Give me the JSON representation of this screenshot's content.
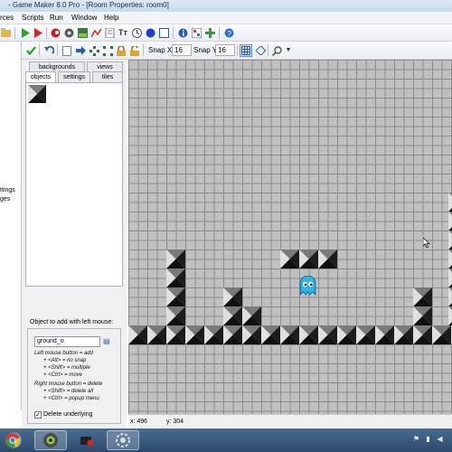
{
  "window": {
    "title": "- Game Maker 8.0 Pro - [Room Properties: room0]"
  },
  "menubar": {
    "items": [
      {
        "label": "rces"
      },
      {
        "label": "Scripts"
      },
      {
        "label": "Run"
      },
      {
        "label": "Window"
      },
      {
        "label": "Help"
      }
    ]
  },
  "room_toolbar": {
    "snap_x_label": "Snap X:",
    "snap_x_value": "16",
    "snap_y_label": "Snap Y:",
    "snap_y_value": "16"
  },
  "left_strip": {
    "fragments": [
      "ttings",
      "ges"
    ]
  },
  "tabs": {
    "row1": [
      {
        "label": "backgrounds"
      },
      {
        "label": "views"
      }
    ],
    "row2": [
      {
        "label": "objects",
        "active": true
      },
      {
        "label": "settings"
      },
      {
        "label": "tiles"
      }
    ]
  },
  "object_panel": {
    "add_label": "Object to add with left mouse:",
    "object_value": "ground_o",
    "hints": [
      "Left mouse button = add",
      "+ <Alt> = no snap",
      "+ <Shift> = multiple",
      "+ <Ctrl> = move",
      "Right mouse button = delete",
      "+ <Shift> = delete all",
      "+ <Ctrl> = popup menu"
    ],
    "delete_underlying_label": "Delete underlying",
    "delete_underlying_checked": true
  },
  "status": {
    "x": "x: 496",
    "y": "y: 304"
  },
  "colors": {
    "grid_background": "#c0c0c0",
    "grid_lines": "#8b8b8b",
    "ghost": "#2ab6e6"
  },
  "icons": {
    "main_toolbar": [
      "open-icon",
      "play-icon",
      "debug-icon",
      "sprite-icon",
      "sound-icon",
      "background-icon",
      "path-icon",
      "script-icon",
      "font-icon",
      "timeline-icon",
      "object-icon",
      "room-icon",
      "game-info-icon",
      "global-settings-icon",
      "extensions-icon",
      "manual-icon"
    ],
    "room_toolbar": [
      "ok-check-icon",
      "undo-icon",
      "clear-room-icon",
      "shift-room-icon",
      "sort-x-icon",
      "sort-y-icon",
      "lock-icon",
      "unlock-icon",
      "grid-toggle-icon",
      "isometric-icon",
      "zoom-icon"
    ]
  }
}
